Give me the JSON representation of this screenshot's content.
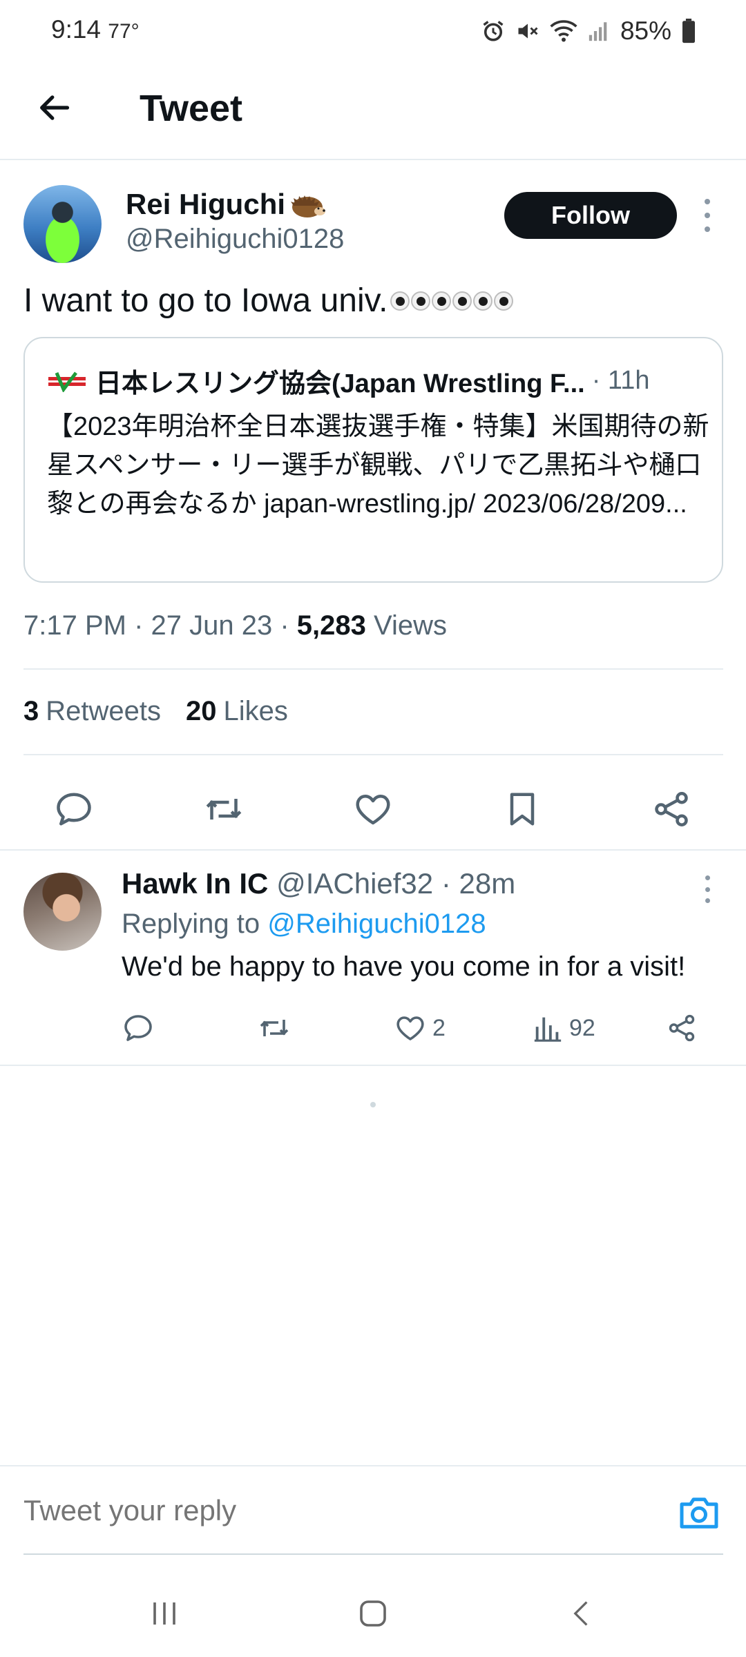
{
  "status_bar": {
    "time": "9:14",
    "temperature": "77°",
    "battery_percent": "85%",
    "icons": [
      "alarm-icon",
      "mute-icon",
      "wifi-icon",
      "signal-icon",
      "battery-icon"
    ]
  },
  "header": {
    "title": "Tweet",
    "back_icon": "back-arrow-icon"
  },
  "tweet": {
    "author_name": "Rei Higuchi",
    "author_emoji": "hedgehog",
    "author_handle": "@Reihiguchi0128",
    "follow_label": "Follow",
    "text": "I want to go to Iowa univ.",
    "text_emoji": "eyes ×3",
    "quote": {
      "name": "日本レスリング協会(Japan Wrestling F...",
      "time": "· 11h",
      "body": "【2023年明治杯全日本選抜選手権・特集】米国期待の新星スペンサー・リー選手が観戦、パリで乙黒拓斗や樋口黎との再会なるか japan-wrestling.jp/ 2023/06/28/209..."
    },
    "time": "7:17 PM",
    "date": "27 Jun 23",
    "views_count": "5,283",
    "views_label": "Views",
    "retweets_count": "3",
    "retweets_label": "Retweets",
    "likes_count": "20",
    "likes_label": "Likes"
  },
  "reply": {
    "name": "Hawk In IC",
    "handle": "@IAChief32",
    "time": "· 28m",
    "replying_to_label": "Replying to",
    "replying_to_handle": "@Reihiguchi0128",
    "text": "We'd be happy to have you come in for a visit!",
    "likes": "2",
    "views": "92"
  },
  "composer": {
    "placeholder": "Tweet your reply"
  },
  "colors": {
    "accent": "#1d9bf0",
    "text_primary": "#0f1419",
    "text_secondary": "#536471",
    "divider": "#e6ecf0"
  }
}
